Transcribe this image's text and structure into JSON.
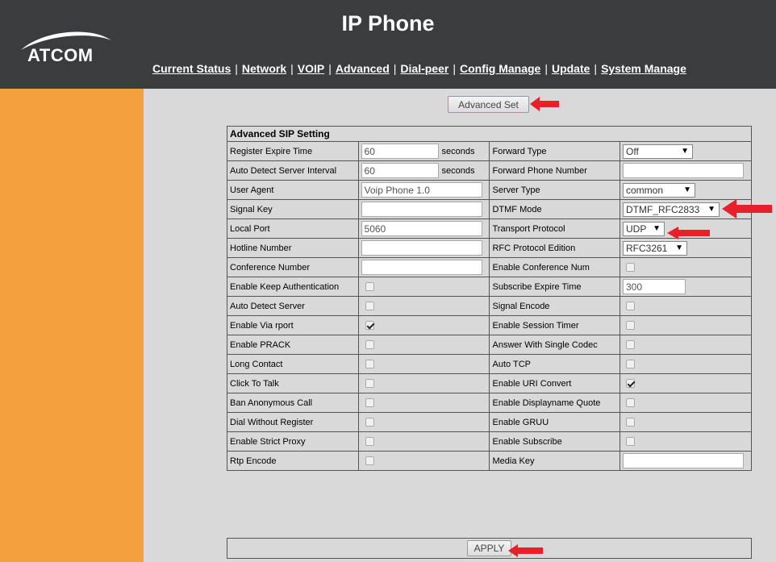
{
  "header": {
    "logo_text": "ATCOM",
    "title": "IP Phone",
    "nav": [
      "Current Status",
      "Network",
      "VOIP",
      "Advanced",
      "Dial-peer",
      "Config Manage",
      "Update",
      "System Manage"
    ],
    "nav_separator": "|"
  },
  "colors": {
    "header_bg": "#3a3c3e",
    "sidebar_bg": "#f4a03f",
    "content_bg": "#d9d9d9",
    "arrow": "#e8202a"
  },
  "advanced_set_button": "Advanced Set",
  "table": {
    "title": "Advanced SIP Setting",
    "register_expire": {
      "label": "Register Expire Time",
      "value": "60",
      "unit": "seconds"
    },
    "auto_detect_interval": {
      "label": "Auto Detect Server Interval",
      "value": "60",
      "unit": "seconds"
    },
    "user_agent": {
      "label": "User Agent",
      "value": "Voip Phone 1.0"
    },
    "signal_key": {
      "label": "Signal Key",
      "value": ""
    },
    "local_port": {
      "label": "Local Port",
      "value": "5060"
    },
    "hotline_number": {
      "label": "Hotline Number",
      "value": ""
    },
    "conference_number": {
      "label": "Conference Number",
      "value": ""
    },
    "forward_type": {
      "label": "Forward Type",
      "value": "Off"
    },
    "forward_phone_number": {
      "label": "Forward Phone Number",
      "value": ""
    },
    "server_type": {
      "label": "Server Type",
      "value": "common"
    },
    "dtmf_mode": {
      "label": "DTMF Mode",
      "value": "DTMF_RFC2833"
    },
    "transport_protocol": {
      "label": "Transport Protocol",
      "value": "UDP"
    },
    "rfc_protocol_edition": {
      "label": "RFC Protocol Edition",
      "value": "RFC3261"
    },
    "enable_conference_num": {
      "label": "Enable Conference Num",
      "checked": false
    },
    "subscribe_expire_time": {
      "label": "Subscribe Expire Time",
      "value": "300"
    },
    "left_checks": [
      {
        "label": "Enable Keep Authentication",
        "checked": false
      },
      {
        "label": "Auto Detect Server",
        "checked": false
      },
      {
        "label": "Enable Via rport",
        "checked": true
      },
      {
        "label": "Enable PRACK",
        "checked": false
      },
      {
        "label": "Long Contact",
        "checked": false
      },
      {
        "label": "Click To Talk",
        "checked": false
      },
      {
        "label": "Ban Anonymous Call",
        "checked": false
      },
      {
        "label": "Dial Without Register",
        "checked": false
      },
      {
        "label": "Enable Strict Proxy",
        "checked": false
      },
      {
        "label": "Rtp Encode",
        "checked": false
      }
    ],
    "right_items": [
      {
        "label": "Signal Encode",
        "checked": false
      },
      {
        "label": "Enable Session Timer",
        "checked": false
      },
      {
        "label": "Answer With Single Codec",
        "checked": false
      },
      {
        "label": "Auto TCP",
        "checked": false
      },
      {
        "label": "Enable URI Convert",
        "checked": true
      },
      {
        "label": "Enable Displayname Quote",
        "checked": false
      },
      {
        "label": "Enable GRUU",
        "checked": false
      },
      {
        "label": "Enable Subscribe",
        "checked": false
      }
    ],
    "media_key": {
      "label": "Media Key",
      "value": ""
    }
  },
  "apply_button": "APPLY"
}
